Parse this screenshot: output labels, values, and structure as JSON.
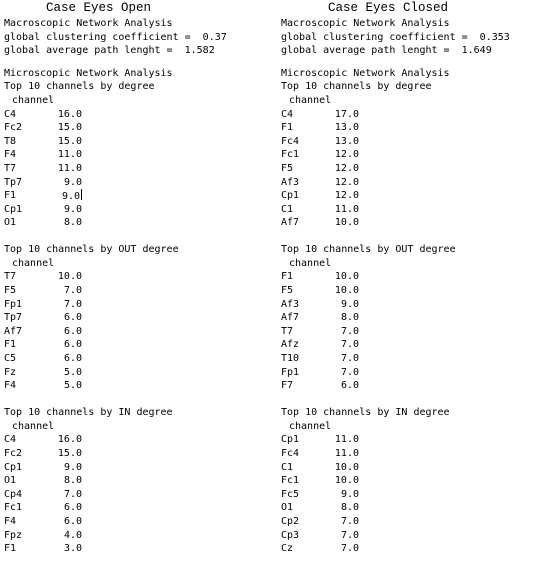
{
  "left": {
    "title": "Case Eyes Open",
    "macro_header": "Macroscopic Network Analysis",
    "clustering": "global clustering coefficient =  0.37",
    "path_length": "global average path lenght =  1.582",
    "micro_header": "Microscopic Network Analysis",
    "sections": [
      {
        "title": "Top 10 channels by degree",
        "col_header": "channel",
        "rows": [
          {
            "ch": "C4",
            "val": "16.0"
          },
          {
            "ch": "Fc2",
            "val": "15.0"
          },
          {
            "ch": "T8",
            "val": "15.0"
          },
          {
            "ch": "F4",
            "val": "11.0"
          },
          {
            "ch": "T7",
            "val": "11.0"
          },
          {
            "ch": "Tp7",
            "val": "9.0"
          },
          {
            "ch": "F1",
            "val": "9.0"
          },
          {
            "ch": "Cp1",
            "val": "9.0"
          },
          {
            "ch": "O1",
            "val": "8.0"
          }
        ]
      },
      {
        "title": "Top 10 channels by OUT degree",
        "col_header": "channel",
        "rows": [
          {
            "ch": "T7",
            "val": "10.0"
          },
          {
            "ch": "F5",
            "val": "7.0"
          },
          {
            "ch": "Fp1",
            "val": "7.0"
          },
          {
            "ch": "Tp7",
            "val": "6.0"
          },
          {
            "ch": "Af7",
            "val": "6.0"
          },
          {
            "ch": "F1",
            "val": "6.0"
          },
          {
            "ch": "C5",
            "val": "6.0"
          },
          {
            "ch": "Fz",
            "val": "5.0"
          },
          {
            "ch": "F4",
            "val": "5.0"
          }
        ]
      },
      {
        "title": "Top 10 channels by IN degree",
        "col_header": "channel",
        "rows": [
          {
            "ch": "C4",
            "val": "16.0"
          },
          {
            "ch": "Fc2",
            "val": "15.0"
          },
          {
            "ch": "Cp1",
            "val": "9.0"
          },
          {
            "ch": "O1",
            "val": "8.0"
          },
          {
            "ch": "Cp4",
            "val": "7.0"
          },
          {
            "ch": "Fc1",
            "val": "6.0"
          },
          {
            "ch": "F4",
            "val": "6.0"
          },
          {
            "ch": "Fpz",
            "val": "4.0"
          },
          {
            "ch": "F1",
            "val": "3.0"
          }
        ]
      }
    ]
  },
  "right": {
    "title": "Case Eyes Closed",
    "macro_header": "Macroscopic Network Analysis",
    "clustering": "global clustering coefficient =  0.353",
    "path_length": "global average path lenght =  1.649",
    "micro_header": "Microscopic Network Analysis",
    "sections": [
      {
        "title": "Top 10 channels by degree",
        "col_header": "channel",
        "rows": [
          {
            "ch": "C4",
            "val": "17.0"
          },
          {
            "ch": "F1",
            "val": "13.0"
          },
          {
            "ch": "Fc4",
            "val": "13.0"
          },
          {
            "ch": "Fc1",
            "val": "12.0"
          },
          {
            "ch": "F5",
            "val": "12.0"
          },
          {
            "ch": "Af3",
            "val": "12.0"
          },
          {
            "ch": "Cp1",
            "val": "12.0"
          },
          {
            "ch": "C1",
            "val": "11.0"
          },
          {
            "ch": "Af7",
            "val": "10.0"
          }
        ]
      },
      {
        "title": "Top 10 channels by OUT degree",
        "col_header": "channel",
        "rows": [
          {
            "ch": "F1",
            "val": "10.0"
          },
          {
            "ch": "F5",
            "val": "10.0"
          },
          {
            "ch": "Af3",
            "val": "9.0"
          },
          {
            "ch": "Af7",
            "val": "8.0"
          },
          {
            "ch": "T7",
            "val": "7.0"
          },
          {
            "ch": "Afz",
            "val": "7.0"
          },
          {
            "ch": "T10",
            "val": "7.0"
          },
          {
            "ch": "Fp1",
            "val": "7.0"
          },
          {
            "ch": "F7",
            "val": "6.0"
          }
        ]
      },
      {
        "title": "Top 10 channels by IN degree",
        "col_header": "channel",
        "rows": [
          {
            "ch": "Cp1",
            "val": "11.0"
          },
          {
            "ch": "Fc4",
            "val": "11.0"
          },
          {
            "ch": "C1",
            "val": "10.0"
          },
          {
            "ch": "Fc1",
            "val": "10.0"
          },
          {
            "ch": "Fc5",
            "val": "9.0"
          },
          {
            "ch": "O1",
            "val": "8.0"
          },
          {
            "ch": "Cp2",
            "val": "7.0"
          },
          {
            "ch": "Cp3",
            "val": "7.0"
          },
          {
            "ch": "Cz",
            "val": "7.0"
          }
        ]
      }
    ]
  }
}
